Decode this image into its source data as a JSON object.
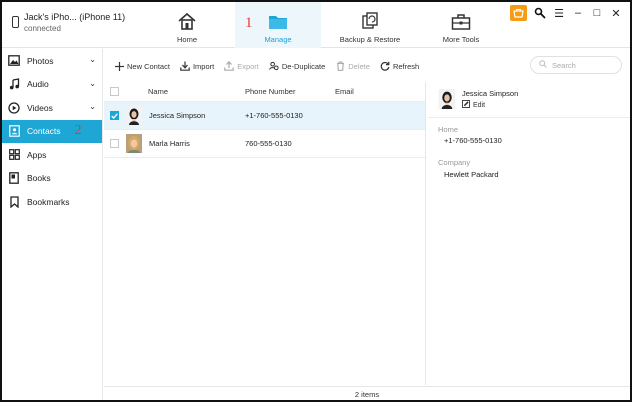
{
  "device": {
    "name": "Jack's iPho... (iPhone 11)",
    "status": "connected"
  },
  "nav": {
    "tabs": [
      {
        "label": "Home",
        "icon": "home-icon"
      },
      {
        "label": "Manage",
        "icon": "folder-icon",
        "active": true
      },
      {
        "label": "Backup & Restore",
        "icon": "backup-restore-icon"
      },
      {
        "label": "More Tools",
        "icon": "toolbox-icon"
      }
    ],
    "annotation": "1"
  },
  "window_controls": {
    "store_icon": "store-badge-icon",
    "search_icon": "key-search-icon",
    "menu": "☰",
    "minimize": "–",
    "maximize": "□",
    "close": "✕"
  },
  "sidebar": {
    "items": [
      {
        "label": "Photos",
        "icon": "photo-icon",
        "expandable": true
      },
      {
        "label": "Audio",
        "icon": "music-note-icon",
        "expandable": true
      },
      {
        "label": "Videos",
        "icon": "play-icon",
        "expandable": true
      },
      {
        "label": "Contacts",
        "icon": "contacts-icon",
        "active": true
      },
      {
        "label": "Apps",
        "icon": "apps-grid-icon"
      },
      {
        "label": "Books",
        "icon": "book-icon"
      },
      {
        "label": "Bookmarks",
        "icon": "bookmark-icon"
      }
    ],
    "annotation": "2"
  },
  "toolbar": {
    "new_contact": "New Contact",
    "import": "Import",
    "export": "Export",
    "deduplicate": "De-Duplicate",
    "delete": "Delete",
    "refresh": "Refresh",
    "search_placeholder": "Search"
  },
  "table": {
    "headers": {
      "name": "Name",
      "phone": "Phone Number",
      "email": "Email"
    },
    "rows": [
      {
        "name": "Jessica  Simpson",
        "phone": "+1-760-555-0130",
        "email": "",
        "checked": true,
        "selected": true
      },
      {
        "name": "Marla Harris",
        "phone": "760-555-0130",
        "email": "",
        "checked": false,
        "selected": false
      }
    ]
  },
  "detail": {
    "name": "Jessica  Simpson",
    "edit_label": "Edit",
    "home_label": "Home",
    "home_value": "+1-760-555-0130",
    "company_label": "Company",
    "company_value": "Hewlett Packard"
  },
  "status": {
    "items_count": "2 items"
  },
  "colors": {
    "accent": "#1ea7d5",
    "active_tab_bg": "#ecf6fb",
    "annotation": "#e53935",
    "store_badge": "#f59b14"
  }
}
